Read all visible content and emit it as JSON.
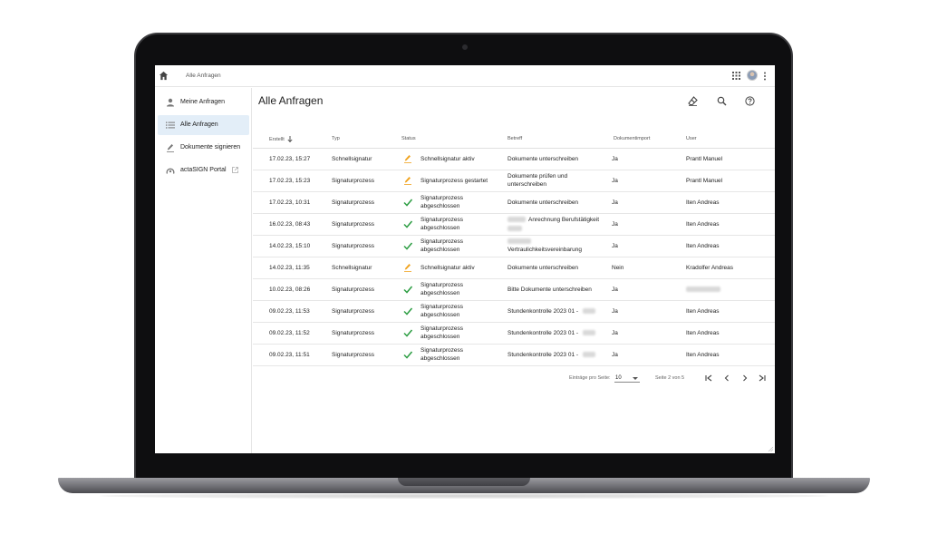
{
  "topbar": {
    "breadcrumb": "Alle Anfragen"
  },
  "sidebar": {
    "items": [
      {
        "label": "Meine Anfragen",
        "icon": "person-icon"
      },
      {
        "label": "Alle Anfragen",
        "icon": "list-icon",
        "active": true
      },
      {
        "label": "Dokumente signieren",
        "icon": "pen-icon"
      },
      {
        "label": "actaSIGN Portal",
        "icon": "portal-icon"
      }
    ]
  },
  "main": {
    "title": "Alle Anfragen"
  },
  "table": {
    "columns": [
      "Erstellt",
      "Typ",
      "Status",
      "Betreff",
      "Dokumentimport",
      "User"
    ],
    "rows": [
      {
        "date": "17.02.23, 15:27",
        "typ": "Schnellsignatur",
        "status_icon": "pen",
        "status": "Schnellsignatur aktiv",
        "betreff": "Dokumente unterschreiben",
        "import": "Ja",
        "user": "Prantl Manuel"
      },
      {
        "date": "17.02.23, 15:23",
        "typ": "Signaturprozess",
        "status_icon": "pen",
        "status": "Signaturprozess gestartet",
        "betreff": "Dokumente prüfen und unterschreiben",
        "import": "Ja",
        "user": "Prantl Manuel"
      },
      {
        "date": "17.02.23, 10:31",
        "typ": "Signaturprozess",
        "status_icon": "check",
        "status": "Signaturprozess abgeschlossen",
        "betreff": "Dokumente unterschreiben",
        "import": "Ja",
        "user": "Iten Andreas"
      },
      {
        "date": "16.02.23, 08:43",
        "typ": "Signaturprozess",
        "status_icon": "check",
        "status": "Signaturprozess abgeschlossen",
        "betreff": "Anrechnung Berufstätigkeit",
        "import": "Ja",
        "user": "Iten Andreas"
      },
      {
        "date": "14.02.23, 15:10",
        "typ": "Signaturprozess",
        "status_icon": "check",
        "status": "Signaturprozess abgeschlossen",
        "betreff": "Vertraulichkeitsvereinbarung",
        "import": "Ja",
        "user": "Iten Andreas"
      },
      {
        "date": "14.02.23, 11:35",
        "typ": "Schnellsignatur",
        "status_icon": "pen",
        "status": "Schnellsignatur aktiv",
        "betreff": "Dokumente unterschreiben",
        "import": "Nein",
        "user": "Kradolfer Andreas"
      },
      {
        "date": "10.02.23, 08:26",
        "typ": "Signaturprozess",
        "status_icon": "check",
        "status": "Signaturprozess abgeschlossen",
        "betreff": "Bitte Dokumente unterschreiben",
        "import": "Ja",
        "user": ""
      },
      {
        "date": "09.02.23, 11:53",
        "typ": "Signaturprozess",
        "status_icon": "check",
        "status": "Signaturprozess abgeschlossen",
        "betreff": "Stundenkontrolle 2023 01 -",
        "import": "Ja",
        "user": "Iten Andreas"
      },
      {
        "date": "09.02.23, 11:52",
        "typ": "Signaturprozess",
        "status_icon": "check",
        "status": "Signaturprozess abgeschlossen",
        "betreff": "Stundenkontrolle 2023 01 -",
        "import": "Ja",
        "user": "Iten Andreas"
      },
      {
        "date": "09.02.23, 11:51",
        "typ": "Signaturprozess",
        "status_icon": "check",
        "status": "Signaturprozess abgeschlossen",
        "betreff": "Stundenkontrolle 2023 01 -",
        "import": "Ja",
        "user": "Iten Andreas"
      }
    ]
  },
  "pagination": {
    "per_page_label": "Einträge pro Seite:",
    "per_page_value": "10",
    "page_info": "Seite 2 von 5"
  },
  "colors": {
    "accent": "#e3eef8",
    "check": "#2e9e44",
    "pen": "#f0a31f"
  }
}
